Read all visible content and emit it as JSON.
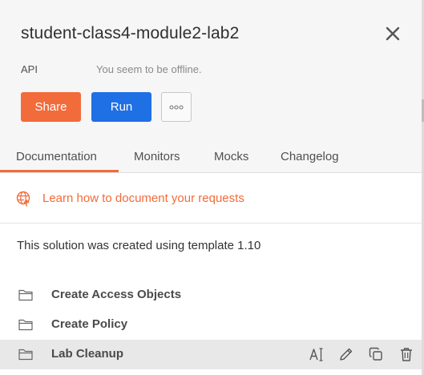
{
  "header": {
    "title": "student-class4-module2-lab2",
    "type_label": "API",
    "status_text": "You seem to be offline.",
    "share_label": "Share",
    "run_label": "Run"
  },
  "tabs": [
    {
      "label": "Documentation",
      "active": true
    },
    {
      "label": "Monitors",
      "active": false
    },
    {
      "label": "Mocks",
      "active": false
    },
    {
      "label": "Changelog",
      "active": false
    }
  ],
  "docs": {
    "learn_link": "Learn how to document your requests",
    "description": "This solution was created using template 1.10"
  },
  "folders": [
    {
      "label": "Create Access Objects",
      "icon": "folder-icon"
    },
    {
      "label": "Create Policy",
      "icon": "folder-icon"
    },
    {
      "label": "Lab Cleanup",
      "icon": "folder-icon",
      "hovered": true
    }
  ],
  "row_actions": [
    "rename-icon",
    "edit-icon",
    "duplicate-icon",
    "delete-icon"
  ],
  "colors": {
    "accent_orange": "#f26b3a",
    "run_blue": "#1f6fe5",
    "header_bg": "#f6f6f6"
  }
}
